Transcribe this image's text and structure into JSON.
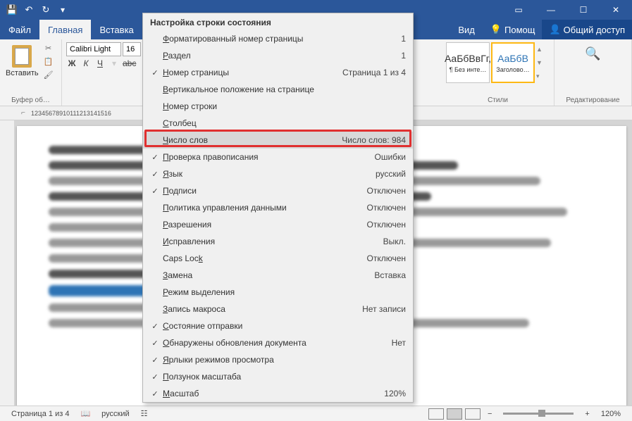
{
  "titlebar": {
    "save": "💾"
  },
  "tabs": {
    "file": "Файл",
    "home": "Главная",
    "insert": "Вставка",
    "view": "Вид",
    "help": "Помощ",
    "share": "Общий доступ"
  },
  "ribbon": {
    "paste": "Вставить",
    "clipboard_label": "Буфер об…",
    "font_name": "Calibri Light",
    "font_size": "16",
    "styles_label": "Стили",
    "style1_prev": "АаБбВвГг,",
    "style1_name": "¶ Без инте…",
    "style2_prev": "АаБбВ",
    "style2_name": "Заголово…",
    "editing": "Редактирование"
  },
  "ruler": {
    "numbers": [
      "1",
      "2",
      "3",
      "4",
      "5",
      "6",
      "7",
      "8",
      "9",
      "10",
      "11",
      "12",
      "13",
      "14",
      "15",
      "16"
    ]
  },
  "ctx": {
    "title": "Настройка строки состояния",
    "items": [
      {
        "check": "",
        "label": "Форматированный номер страницы",
        "ul": "Ф",
        "rest": "орматированный номер страницы",
        "val": "1"
      },
      {
        "check": "",
        "label": "Раздел",
        "ul": "Р",
        "rest": "аздел",
        "val": "1"
      },
      {
        "check": "✓",
        "label": "Номер страницы",
        "ul": "Н",
        "rest": "омер страницы",
        "val": "Страница 1 из 4"
      },
      {
        "check": "",
        "label": "Вертикальное положение на странице",
        "ul": "В",
        "rest": "ертикальное положение на странице",
        "val": ""
      },
      {
        "check": "",
        "label": "Номер строки",
        "ul": "Н",
        "rest": "омер строки",
        "val": ""
      },
      {
        "check": "",
        "label": "Столбец",
        "ul": "С",
        "rest": "толбец",
        "val": ""
      },
      {
        "check": "",
        "label": "Число слов",
        "ul": "Ч",
        "rest": "исло слов",
        "val": "Число слов: 984",
        "hl": true
      },
      {
        "check": "✓",
        "label": "Проверка правописания",
        "ul": "П",
        "rest": "роверка правописания",
        "val": "Ошибки"
      },
      {
        "check": "✓",
        "label": "Язык",
        "ul": "Я",
        "rest": "зык",
        "val": "русский"
      },
      {
        "check": "✓",
        "label": "Подписи",
        "ul": "П",
        "rest": "одписи",
        "val": "Отключен"
      },
      {
        "check": "",
        "label": "Политика управления данными",
        "ul": "П",
        "rest": "олитика управления данными",
        "val": "Отключен"
      },
      {
        "check": "",
        "label": "Разрешения",
        "ul": "Р",
        "rest": "азрешения",
        "val": "Отключен"
      },
      {
        "check": "",
        "label": "Исправления",
        "ul": "И",
        "rest": "справления",
        "val": "Выкл."
      },
      {
        "check": "",
        "label": "Caps Lock",
        "ul": "k",
        "pre": "Caps Loc",
        "rest": "",
        "val": "Отключен"
      },
      {
        "check": "",
        "label": "Замена",
        "ul": "З",
        "rest": "амена",
        "val": "Вставка"
      },
      {
        "check": "",
        "label": "Режим выделения",
        "ul": "Р",
        "rest": "ежим выделения",
        "val": ""
      },
      {
        "check": "",
        "label": "Запись макроса",
        "ul": "З",
        "rest": "апись макроса",
        "val": "Нет записи"
      },
      {
        "check": "✓",
        "label": "Состояние отправки",
        "ul": "С",
        "rest": "остояние отправки",
        "val": ""
      },
      {
        "check": "✓",
        "label": "Обнаружены обновления документа",
        "ul": "О",
        "rest": "бнаружены обновления документа",
        "val": "Нет"
      },
      {
        "check": "✓",
        "label": "Ярлыки режимов просмотра",
        "ul": "Я",
        "rest": "рлыки режимов просмотра",
        "val": ""
      },
      {
        "check": "✓",
        "label": "Ползунок масштаба",
        "ul": "П",
        "rest": "олзунок масштаба",
        "val": ""
      },
      {
        "check": "✓",
        "label": "Масштаб",
        "ul": "М",
        "rest": "асштаб",
        "val": "120%"
      }
    ]
  },
  "status": {
    "page": "Страница 1 из 4",
    "lang": "русский",
    "zoom": "120%"
  }
}
